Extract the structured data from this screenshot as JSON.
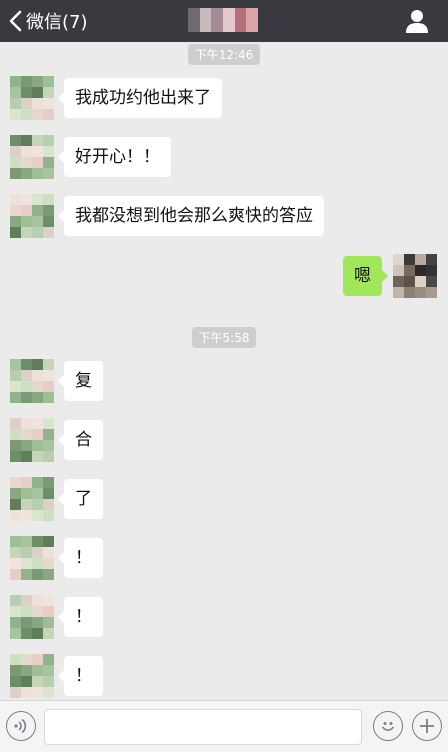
{
  "header": {
    "back_label": "微信(7)",
    "title_blur_colors": [
      "#6e6a70",
      "#c7b9bd",
      "#a58c94",
      "#e3c9cc",
      "#b46f7a",
      "#d9a4aa"
    ]
  },
  "timestamps": [
    "下午12:46",
    "下午5:58"
  ],
  "messages": [
    {
      "side": "left",
      "text": "我成功约他出来了"
    },
    {
      "side": "left",
      "text": "好开心！！"
    },
    {
      "side": "left",
      "text": "我都没想到他会那么爽快的答应"
    },
    {
      "side": "right",
      "text": "嗯"
    },
    {
      "side": "left",
      "text": "复"
    },
    {
      "side": "left",
      "text": "合"
    },
    {
      "side": "left",
      "text": "了"
    },
    {
      "side": "left",
      "text": "！"
    },
    {
      "side": "left",
      "text": "！"
    },
    {
      "side": "left",
      "text": "！"
    }
  ],
  "input": {
    "value": "",
    "placeholder": ""
  },
  "colors": {
    "topbar": "#393a3f",
    "background": "#ebebeb",
    "self_bubble": "#a0e75a",
    "other_bubble": "#ffffff"
  },
  "icons": {
    "back": "chevron-left-icon",
    "profile": "person-icon",
    "voice": "voice-icon",
    "emoji": "emoji-icon",
    "plus": "plus-icon"
  }
}
